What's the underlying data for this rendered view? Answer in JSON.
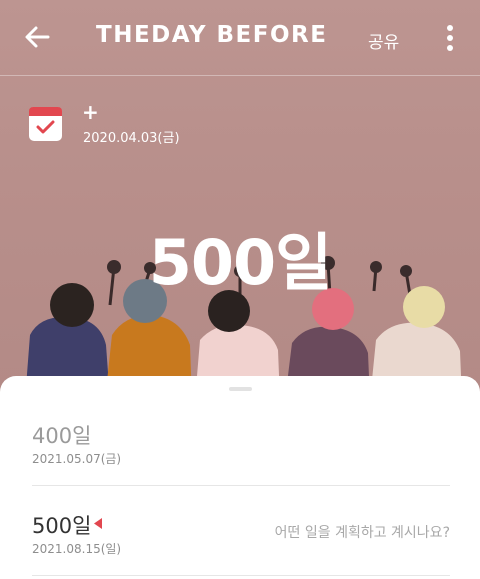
{
  "header": {
    "title": "THEDAY BEFORE",
    "share_label": "공유",
    "back_icon": "arrow-left-icon",
    "more_icon": "more-vertical-icon"
  },
  "event": {
    "calendar_icon": "calendar-check-icon",
    "sign": "+",
    "start_date": "2020.04.03(금)",
    "count": "500일"
  },
  "milestones": [
    {
      "label": "400일",
      "date": "2021.05.07(금)"
    },
    {
      "label": "500일",
      "date": "2021.08.15(일)",
      "current": true,
      "prompt": "어떤 일을 계획하고 계시나요?"
    }
  ],
  "colors": {
    "background": "#b9918d",
    "accent": "#e2474f",
    "sheet": "#ffffff"
  }
}
